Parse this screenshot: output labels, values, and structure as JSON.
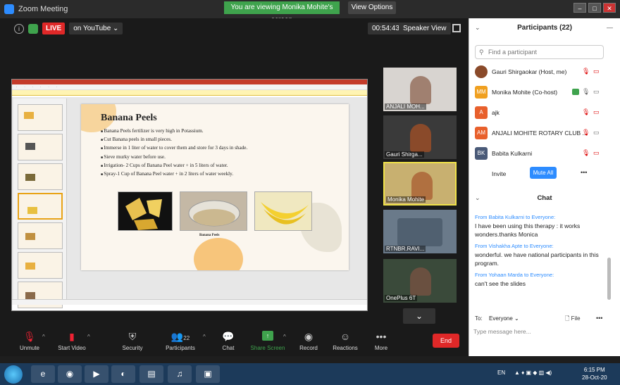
{
  "titlebar": {
    "app_title": "Zoom Meeting",
    "viewing_banner": "You are viewing Monika Mohite's screen",
    "view_options": "View Options ⌄"
  },
  "stage": {
    "live_label": "LIVE",
    "youtube_label": "on YouTube ⌄",
    "timer": "00:54:43",
    "speaker_view": "Speaker View"
  },
  "slide": {
    "title": "Banana Peels",
    "bullets": [
      "Banana Peels fertilizer is very high in Potassium.",
      "Cut Banana peels in small pieces.",
      "Immerse in 1 liter of water to cover them and store for 3 days in shade.",
      "Sieve murky water before use.",
      "Irrigation- 2 Cups of Banana Peel water + in 5 liters of water.",
      "Spray-1 Cup of Banana Peel water + in 2 liters of water weekly."
    ],
    "caption": "Banana Peels"
  },
  "video_tiles": [
    {
      "name": "ANJALI MOH...",
      "color": "#a08070"
    },
    {
      "name": "Gauri Shirga...",
      "color": "#8a4a2a"
    },
    {
      "name": "Monika Mohite",
      "color": "#b07040"
    },
    {
      "name": "RTNBR.RAVI...",
      "color": "#506070"
    },
    {
      "name": "OnePlus 6T",
      "color": "#6a5040"
    }
  ],
  "toolbar": {
    "unmute": "Unmute",
    "start_video": "Start Video",
    "security": "Security",
    "participants": "Participants",
    "participants_count": "22",
    "chat": "Chat",
    "share_screen": "Share Screen",
    "record": "Record",
    "reactions": "Reactions",
    "more": "More",
    "end": "End"
  },
  "panel": {
    "title": "Participants (22)",
    "search_placeholder": "Find a participant",
    "participants": [
      {
        "name": "Gauri Shirgaokar (Host, me)",
        "initials": "",
        "color": "#8a4a2a"
      },
      {
        "name": "Monika Mohite (Co-host)",
        "initials": "MM",
        "color": "#f0a020"
      },
      {
        "name": "ajk",
        "initials": "A",
        "color": "#e8602c"
      },
      {
        "name": "ANJALI MOHITE ROTARY CLUB ...",
        "initials": "AM",
        "color": "#e8602c"
      },
      {
        "name": "Babita Kulkarni",
        "initials": "BK",
        "color": "#4a5a78"
      }
    ],
    "invite": "Invite",
    "mute_all": "Mute All",
    "chat_title": "Chat",
    "messages": [
      {
        "from": "From Babita Kulkarni to Everyone:",
        "text": "I have been using this therapy : it works wonders.thanks Monica"
      },
      {
        "from": "From Vishakha Apte to Everyone:",
        "text": "wonderful. we have national participants in this program."
      },
      {
        "from": "From Yohaan Marda to Everyone:",
        "text": "can't see the slides"
      }
    ],
    "to_label": "To:",
    "to_value": "Everyone ⌄",
    "file": "File",
    "input_placeholder": "Type message here..."
  },
  "taskbar": {
    "lang": "EN",
    "time": "6:15 PM",
    "date": "28-Oct-20"
  }
}
